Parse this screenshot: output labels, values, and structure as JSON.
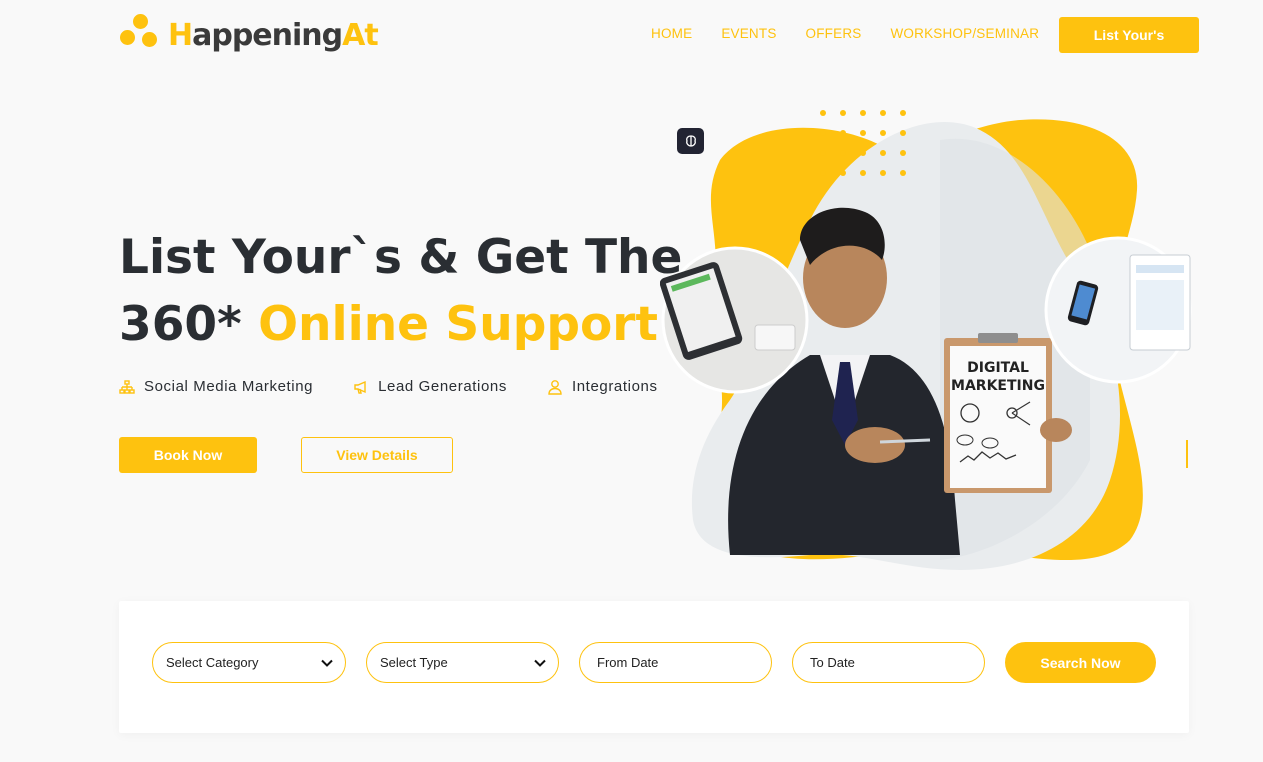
{
  "brand": {
    "name_part1": "H",
    "name_part2": "appening",
    "name_part3": "At",
    "accent": "#fec20f",
    "dark": "#2a2e33"
  },
  "nav": {
    "items": [
      {
        "label": "HOME"
      },
      {
        "label": "EVENTS"
      },
      {
        "label": "OFFERS"
      },
      {
        "label": "WORKSHOP/SEMINAR"
      }
    ]
  },
  "header": {
    "cta_label": "List Your's"
  },
  "hero": {
    "title_line1": "List Your`s & Get The",
    "title_line2_plain": "360* ",
    "title_line2_highlight": "Online Support",
    "features": [
      {
        "label": "Social Media Marketing",
        "icon": "sitemap-icon"
      },
      {
        "label": "Lead Generations",
        "icon": "megaphone-icon"
      },
      {
        "label": "Integrations",
        "icon": "user-icon"
      }
    ],
    "primary_button": "Book Now",
    "secondary_button": "View Details",
    "clipboard_text_line1": "DIGITAL",
    "clipboard_text_line2": "MARKETING"
  },
  "search": {
    "category_label": "Select Category",
    "type_label": "Select Type",
    "from_placeholder": "From Date",
    "to_placeholder": "To Date",
    "button_label": "Search Now"
  }
}
